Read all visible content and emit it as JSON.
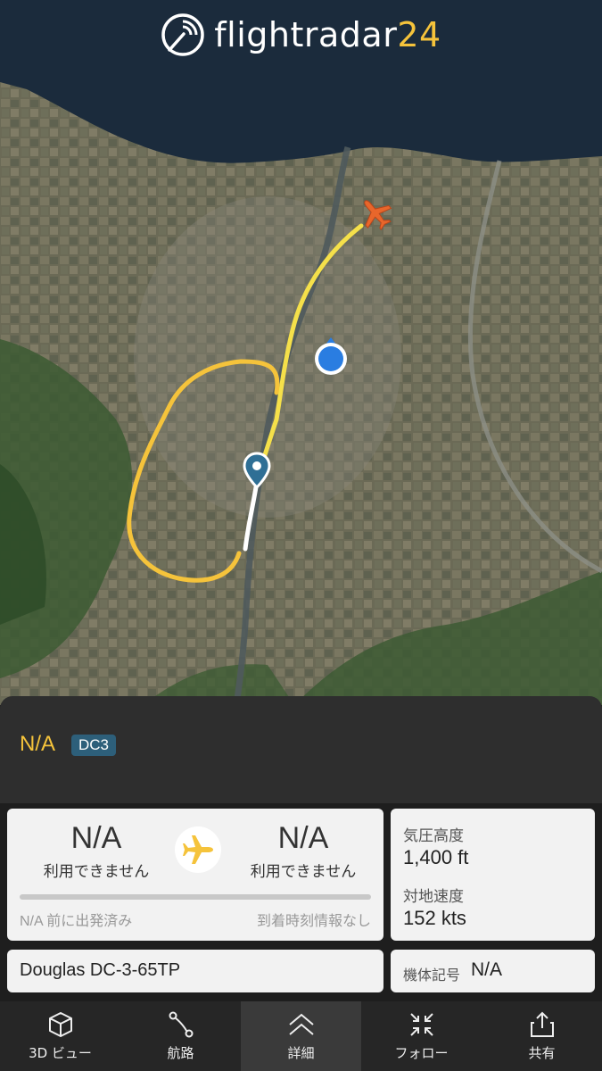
{
  "logo": {
    "word": "flightradar",
    "num": "24"
  },
  "flight": {
    "id": "N/A",
    "type_badge": "DC3"
  },
  "route": {
    "origin": {
      "code": "N/A",
      "city": "利用できません"
    },
    "destination": {
      "code": "N/A",
      "city": "利用できません"
    },
    "progress": 0,
    "departure_status": "N/A 前に出発済み",
    "arrival_status": "到着時刻情報なし"
  },
  "stats": {
    "altitude_label": "気圧高度",
    "altitude_value": "1,400 ft",
    "speed_label": "対地速度",
    "speed_value": "152 kts"
  },
  "aircraft": {
    "model": "Douglas DC-3-65TP",
    "registration_label": "機体記号",
    "registration_value": "N/A"
  },
  "tabs": [
    {
      "label": "3D ビュー",
      "icon": "cube-icon"
    },
    {
      "label": "航路",
      "icon": "route-icon"
    },
    {
      "label": "詳細",
      "icon": "chevron-up-icon"
    },
    {
      "label": "フォロー",
      "icon": "collapse-arrows-icon"
    },
    {
      "label": "共有",
      "icon": "share-icon"
    }
  ],
  "colors": {
    "accent": "#f5c33b",
    "badge": "#2d5f7a",
    "track": "#f5e04a",
    "aircraft": "#e8662b",
    "user_location": "#2a7de1"
  }
}
